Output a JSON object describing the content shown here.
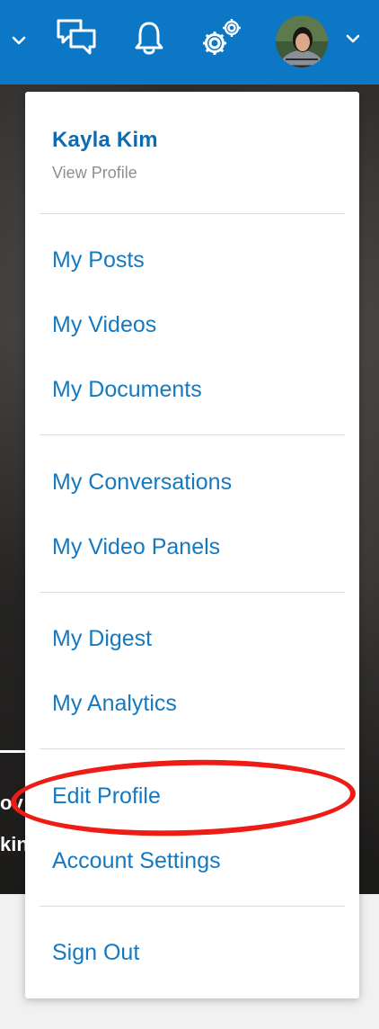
{
  "header": {
    "icons": [
      "chevron-down-icon",
      "chat-icon",
      "bell-icon",
      "gears-icon",
      "avatar",
      "chevron-down-icon"
    ],
    "background_color": "#0b77c5"
  },
  "background": {
    "partial_text_line1": "ov",
    "partial_text_line2": "kin"
  },
  "menu": {
    "user_name": "Kayla Kim",
    "view_profile": "View Profile",
    "groups": [
      [
        "My Posts",
        "My Videos",
        "My Documents"
      ],
      [
        "My Conversations",
        "My Video Panels"
      ],
      [
        "My Digest",
        "My Analytics"
      ],
      [
        "Edit Profile",
        "Account Settings"
      ],
      [
        "Sign Out"
      ]
    ],
    "link_color": "#1679c0",
    "highlighted_item": "Edit Profile",
    "highlight_color": "#ee1c15"
  }
}
